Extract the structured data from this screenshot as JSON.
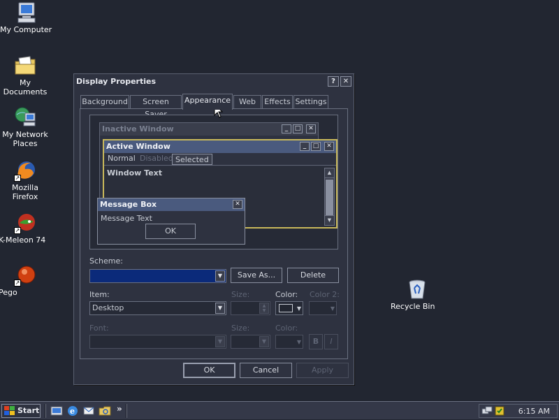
{
  "desktop": {
    "icons": [
      {
        "label": "My Computer"
      },
      {
        "label": "My Documents"
      },
      {
        "label": "My Network Places"
      },
      {
        "label": "Mozilla Firefox"
      },
      {
        "label": "K-Meleon 74"
      },
      {
        "label": "Pego"
      },
      {
        "label": "Recycle Bin"
      }
    ]
  },
  "dialog": {
    "title": "Display Properties",
    "help_btn": "?",
    "close_btn": "✕",
    "tabs": [
      "Background",
      "Screen Saver",
      "Appearance",
      "Web",
      "Effects",
      "Settings"
    ],
    "active_tab": "Appearance",
    "preview": {
      "inactive_title": "Inactive Window",
      "active_title": "Active Window",
      "menu_normal": "Normal",
      "menu_disabled": "Disabled",
      "menu_selected": "Selected",
      "window_text": "Window Text",
      "msg_title": "Message Box",
      "msg_text": "Message Text",
      "msg_ok": "OK",
      "min": "_",
      "max": "□",
      "close": "✕"
    },
    "scheme_label": "Scheme:",
    "scheme_value": "",
    "save_as": "Save As...",
    "delete": "Delete",
    "item_label": "Item:",
    "item_value": "Desktop",
    "size_label": "Size:",
    "color_label": "Color:",
    "color2_label": "Color 2:",
    "font_label": "Font:",
    "font_size_label": "Size:",
    "font_color_label": "Color:",
    "bold": "B",
    "italic": "I",
    "ok": "OK",
    "cancel": "Cancel",
    "apply": "Apply"
  },
  "taskbar": {
    "start": "Start",
    "more": "»",
    "clock": "6:15 AM"
  },
  "colors": {
    "desktop": "#222631",
    "active_title": "#4a5a7e",
    "selection": "#0b2a7a",
    "highlight_border": "#c8b85a"
  }
}
